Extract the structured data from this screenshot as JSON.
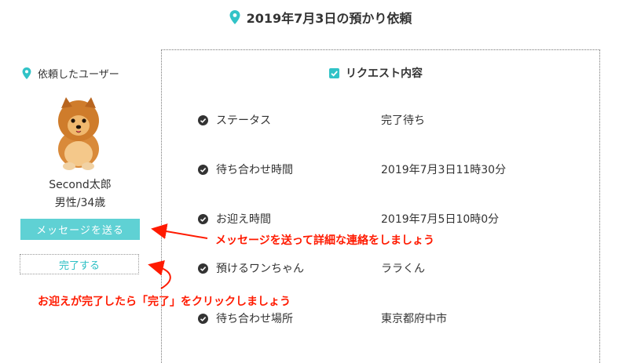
{
  "page": {
    "title": "2019年7月3日の預かり依頼"
  },
  "user": {
    "heading": "依頼したユーザー",
    "name": "Second太郎",
    "profile": "男性/34歳",
    "message_button": "メッセージを送る",
    "complete_button": "完了する"
  },
  "request": {
    "heading": "リクエスト内容",
    "rows": [
      {
        "label": "ステータス",
        "value": "完了待ち"
      },
      {
        "label": "待ち合わせ時間",
        "value": "2019年7月3日11時30分"
      },
      {
        "label": "お迎え時間",
        "value": "2019年7月5日10時0分"
      },
      {
        "label": "預けるワンちゃん",
        "value": "ララくん"
      },
      {
        "label": "待ち合わせ場所",
        "value": "東京都府中市"
      }
    ]
  },
  "annotations": {
    "message_hint": "メッセージを送って詳細な連絡をしましょう",
    "complete_hint": "お迎えが完了したら「完了」をクリックしましょう"
  },
  "colors": {
    "accent": "#31c3c7",
    "button_bg": "#5fd1d4",
    "annotation": "#ff1a00"
  }
}
